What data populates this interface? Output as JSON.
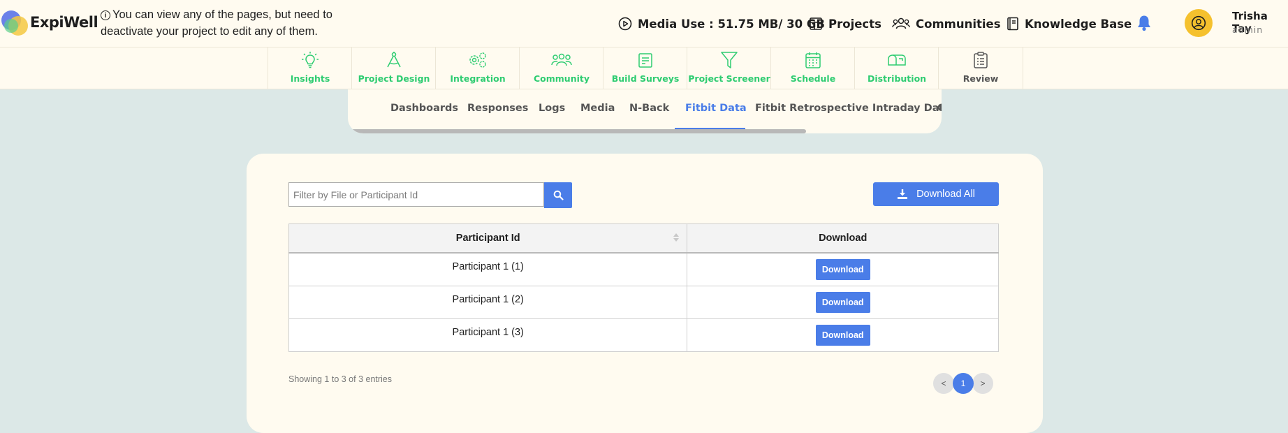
{
  "brand": "ExpiWell",
  "notice": "You can view any of the pages, but need to deactivate your project to edit any of them.",
  "topnav": {
    "media_use": "Media Use : 51.75 MB/ 30 GB",
    "projects": "Projects",
    "communities": "Communities",
    "knowledge_base": "Knowledge Base"
  },
  "user": {
    "name": "Trisha Tay",
    "role": "admin"
  },
  "modules": [
    {
      "label": "Insights",
      "icon": "lightbulb-icon"
    },
    {
      "label": "Project Design",
      "icon": "compass-icon"
    },
    {
      "label": "Integration",
      "icon": "gears-icon"
    },
    {
      "label": "Community",
      "icon": "people-icon"
    },
    {
      "label": "Build Surveys",
      "icon": "form-icon"
    },
    {
      "label": "Project Screener",
      "icon": "filter-icon"
    },
    {
      "label": "Schedule",
      "icon": "calendar-icon"
    },
    {
      "label": "Distribution",
      "icon": "mailbox-icon"
    },
    {
      "label": "Review",
      "icon": "clipboard-icon"
    }
  ],
  "subtabs": [
    "Dashboards",
    "Responses",
    "Logs",
    "Media",
    "N-Back",
    "Fitbit Data",
    "Fitbit Retrospective Intraday Data",
    "C"
  ],
  "active_subtab": "Fitbit Data",
  "filter": {
    "placeholder": "Filter by File or Participant Id"
  },
  "download_all": "Download All",
  "table": {
    "headers": [
      "Participant Id",
      "Download"
    ],
    "rows": [
      {
        "participant": "Participant 1 (1)",
        "action": "Download"
      },
      {
        "participant": "Participant 1 (2)",
        "action": "Download"
      },
      {
        "participant": "Participant 1 (3)",
        "action": "Download"
      }
    ]
  },
  "entries_text": "Showing 1 to 3 of 3 entries",
  "pagination": {
    "prev": "<",
    "current": "1",
    "next": ">"
  },
  "colors": {
    "accent": "#4a7de8",
    "module_green": "#2ecc71",
    "background": "#dce8e7",
    "panel": "#fffbf0"
  }
}
